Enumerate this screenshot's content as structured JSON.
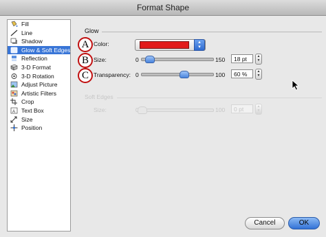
{
  "window": {
    "title": "Format Shape"
  },
  "sidebar": {
    "items": [
      {
        "label": "Fill",
        "icon": "fill-icon"
      },
      {
        "label": "Line",
        "icon": "line-icon"
      },
      {
        "label": "Shadow",
        "icon": "shadow-icon"
      },
      {
        "label": "Glow & Soft Edges",
        "icon": "glow-icon",
        "selected": true
      },
      {
        "label": "Reflection",
        "icon": "reflection-icon"
      },
      {
        "label": "3-D Format",
        "icon": "3d-format-icon"
      },
      {
        "label": "3-D Rotation",
        "icon": "3d-rotation-icon"
      },
      {
        "label": "Adjust Picture",
        "icon": "adjust-picture-icon"
      },
      {
        "label": "Artistic Filters",
        "icon": "artistic-filters-icon"
      },
      {
        "label": "Crop",
        "icon": "crop-icon"
      },
      {
        "label": "Text Box",
        "icon": "text-box-icon"
      },
      {
        "label": "Size",
        "icon": "size-icon"
      },
      {
        "label": "Position",
        "icon": "position-icon"
      }
    ]
  },
  "glow": {
    "section_title": "Glow",
    "color": {
      "marker": "A",
      "label": "Color:",
      "value": "#e21b1b"
    },
    "size": {
      "marker": "B",
      "label": "Size:",
      "min": "0",
      "max": "150",
      "value": "18 pt",
      "fraction": 0.12
    },
    "transparency": {
      "marker": "C",
      "label": "Transparency:",
      "min": "0",
      "max": "100",
      "value": "60 %",
      "fraction": 0.6
    }
  },
  "soft_edges": {
    "section_title": "Soft Edges",
    "size": {
      "label": "Size:",
      "min": "0",
      "max": "100",
      "value": "0 pt"
    }
  },
  "footer": {
    "cancel_label": "Cancel",
    "ok_label": "OK"
  },
  "colors": {
    "accent": "#3875d7",
    "marker": "#c01010"
  }
}
